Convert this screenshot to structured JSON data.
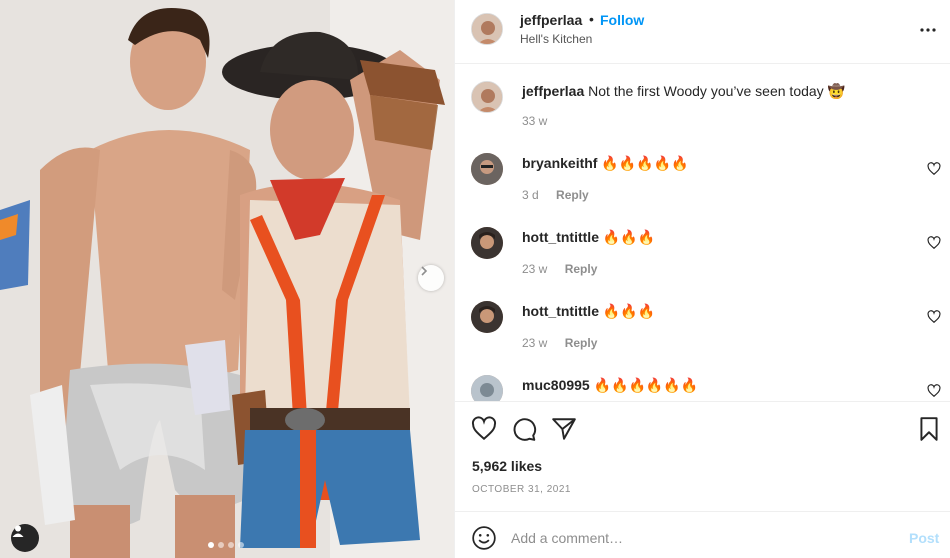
{
  "post": {
    "photo_description": "Two men in costumes posing against a white wall",
    "carousel_dots": 4,
    "carousel_active": 0
  },
  "header": {
    "username": "jeffperlaa",
    "separator": "•",
    "follow_label": "Follow",
    "location": "Hell's Kitchen"
  },
  "caption": {
    "username": "jeffperlaa",
    "text": "Not the first Woody you’ve seen today 🤠",
    "time": "33 w"
  },
  "comments": [
    {
      "username": "bryankeithf",
      "text": "🔥🔥🔥🔥🔥",
      "time": "3 d",
      "reply_label": "Reply"
    },
    {
      "username": "hott_tntittle",
      "text": "🔥🔥🔥",
      "time": "23 w",
      "reply_label": "Reply"
    },
    {
      "username": "hott_tntittle",
      "text": "🔥🔥🔥",
      "time": "23 w",
      "reply_label": "Reply"
    },
    {
      "username": "muc80995",
      "text": "🔥🔥🔥🔥🔥🔥",
      "time": "",
      "reply_label": ""
    }
  ],
  "stats": {
    "likes": "5,962 likes",
    "date": "OCTOBER 31, 2021"
  },
  "add_comment": {
    "placeholder": "Add a comment…",
    "post_label": "Post"
  },
  "colors": {
    "accent": "#0095f6",
    "post_disabled": "#b2dffc",
    "text": "#262626",
    "muted": "#8e8e8e"
  }
}
